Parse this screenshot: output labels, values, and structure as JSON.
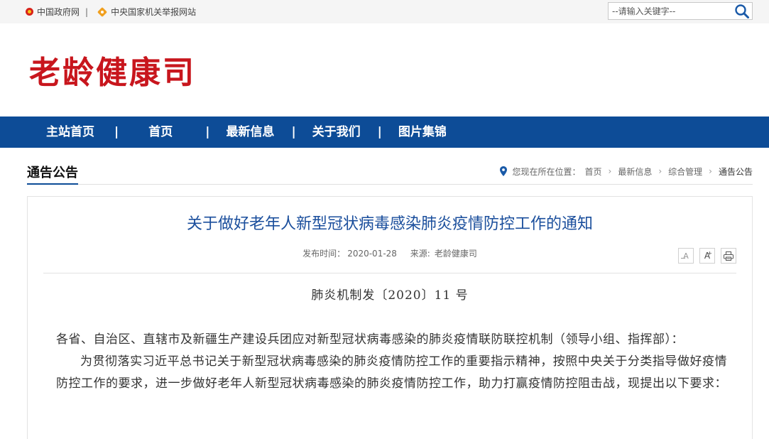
{
  "topbar": {
    "links": [
      {
        "label": "中国政府网",
        "icon": "national-emblem-icon"
      },
      {
        "label": "中央国家机关举报网站",
        "icon": "report-icon"
      }
    ],
    "separator": "|",
    "search": {
      "placeholder": "--请输入关键字--",
      "icon": "search-icon"
    }
  },
  "header": {
    "site_title": "老龄健康司",
    "title_color": "#c8161d"
  },
  "nav": {
    "items": [
      "主站首页",
      "首页",
      "最新信息",
      "关于我们",
      "图片集锦"
    ],
    "separator": "|",
    "background": "#0d4c97"
  },
  "section": {
    "title": "通告公告"
  },
  "breadcrumb": {
    "prefix": "您现在所在位置：",
    "items": [
      "首页",
      "最新信息",
      "综合管理",
      "通告公告"
    ],
    "arrow": "›"
  },
  "article": {
    "title": "关于做好老年人新型冠状病毒感染肺炎疫情防控工作的通知",
    "title_color": "#1a4e9c",
    "date_label": "发布时间：",
    "date": "2020-01-28",
    "source_label": "来源:",
    "source": "老龄健康司",
    "tools": {
      "font_smaller": "A",
      "font_larger": "A",
      "font_larger_sup": "+",
      "print_icon": "printer-icon"
    },
    "doc_number": "肺炎机制发〔2020〕11 号",
    "paragraphs": [
      "各省、自治区、直辖市及新疆生产建设兵团应对新型冠状病毒感染的肺炎疫情联防联控机制（领导小组、指挥部）：",
      "为贯彻落实习近平总书记关于新型冠状病毒感染的肺炎疫情防控工作的重要指示精神，按照中央关于分类指导做好疫情防控工作的要求，进一步做好老年人新型冠状病毒感染的肺炎疫情防控工作，助力打赢疫情防控阻击战，现提出以下要求："
    ]
  }
}
